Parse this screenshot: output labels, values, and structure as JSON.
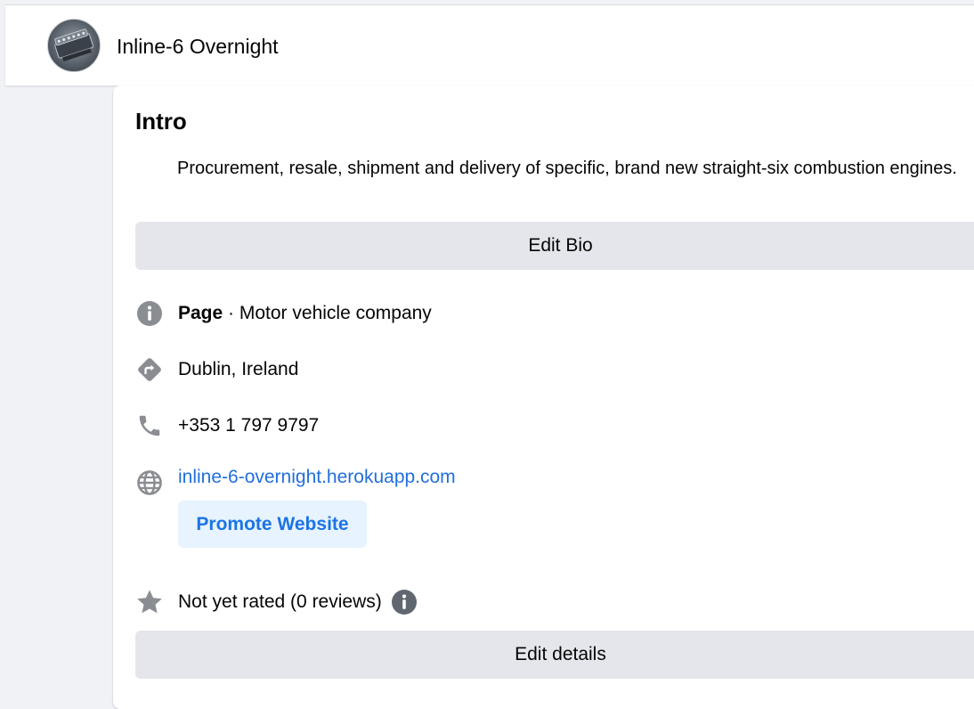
{
  "header": {
    "page_name": "Inline-6 Overnight",
    "avatar_icon": "engine-block-photo"
  },
  "intro": {
    "title": "Intro",
    "bio": "Procurement, resale, shipment and delivery of specific, brand new straight-six combustion engines.",
    "edit_bio_label": "Edit Bio",
    "details": {
      "category_label": "Page",
      "category_separator": " · ",
      "category_value": "Motor vehicle company",
      "location": "Dublin, Ireland",
      "phone": "+353 1 797 9797",
      "website": "inline-6-overnight.herokuapp.com",
      "promote_website_label": "Promote Website",
      "rating": "Not yet rated (0 reviews)"
    },
    "edit_details_label": "Edit details"
  },
  "icons": {
    "info": "info-icon",
    "location": "directions-icon",
    "phone": "phone-icon",
    "website": "globe-icon",
    "rating": "star-icon",
    "rating_info": "info-icon"
  },
  "colors": {
    "link": "#216fdb",
    "promote_text": "#1b74e4",
    "promote_bg": "#e7f3ff",
    "button_bg": "#e4e6eb",
    "icon_gray": "#8a8d91"
  }
}
